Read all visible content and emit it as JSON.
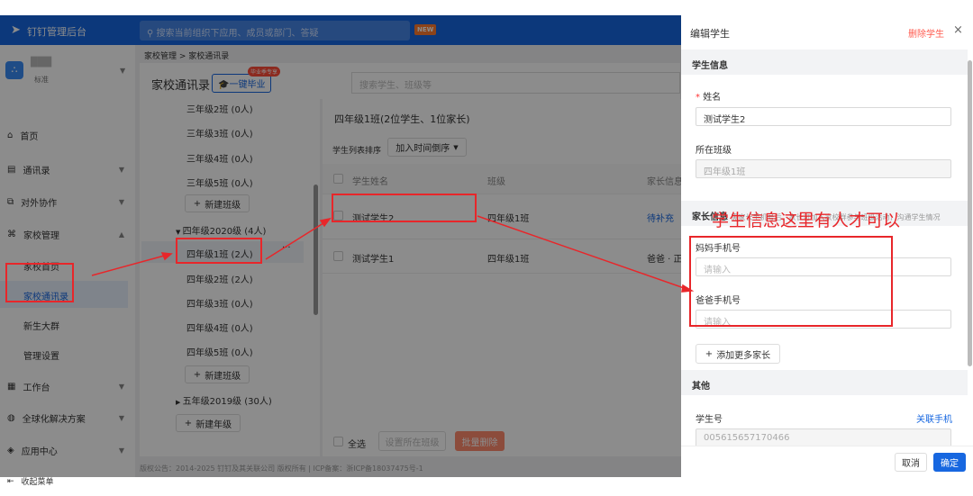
{
  "topbar": {
    "logo": "钉钉管理后台",
    "search_placeholder": "搜索当前组织下应用、成员或部门、答疑",
    "new_badge": "NEW"
  },
  "org": {
    "name": "███",
    "tag": "标准"
  },
  "sidebar": {
    "items": [
      {
        "label": "首页",
        "icon": "home-icon"
      },
      {
        "label": "通讯录",
        "icon": "contacts-icon"
      },
      {
        "label": "对外协作",
        "icon": "collab-icon"
      },
      {
        "label": "家校管理",
        "icon": "school-icon"
      },
      {
        "label": "工作台",
        "icon": "grid-icon"
      },
      {
        "label": "全球化解决方案",
        "icon": "globe-icon"
      },
      {
        "label": "应用中心",
        "icon": "app-icon"
      }
    ],
    "sub_items": [
      "家校首页",
      "家校通讯录",
      "新生大群",
      "管理设置"
    ],
    "collapse": "收起菜单"
  },
  "breadcrumb": [
    "家校管理",
    "家校通讯录"
  ],
  "page": {
    "title": "家校通讯录",
    "graduate_button": "一键毕业",
    "graduate_badge": "毕业季专享",
    "search_placeholder": "搜索学生、班级等"
  },
  "tree": {
    "nodes": [
      "三年级2班 (0人)",
      "三年级3班 (0人)",
      "三年级4班 (0人)",
      "三年级5班 (0人)"
    ],
    "new_class": "新建班级",
    "grade2020": "四年级2020级 (4人)",
    "classes2020": [
      "四年级1班 (2人)",
      "四年级2班 (2人)",
      "四年级3班 (0人)",
      "四年级4班 (0人)",
      "四年级5班 (0人)"
    ],
    "grade2019": "五年级2019级 (30人)",
    "new_grade": "新建年级"
  },
  "list": {
    "title": "四年级1班(2位学生、1位家长)",
    "sort_label": "学生列表排序",
    "sort_value": "加入时间倒序",
    "columns": [
      "学生姓名",
      "班级",
      "家长信息"
    ],
    "rows": [
      {
        "name": "测试学生2",
        "class": "四年级1班",
        "parent": "待补充"
      },
      {
        "name": "测试学生1",
        "class": "四年级1班",
        "parent": "爸爸 · 正"
      }
    ],
    "select_all": "全选",
    "set_class": "设置所在班级",
    "batch_delete": "批量删除"
  },
  "footer": "版权公告：2014-2025 钉钉及其关联公司 版权所有 | ICP备案：浙ICP备18037475号-1",
  "drawer": {
    "title": "编辑学生",
    "delete": "删除学生",
    "section_student": "学生信息",
    "name_label": "姓名",
    "name_value": "测试学生2",
    "class_label": "所在班级",
    "class_value": "四年级1班",
    "section_parent": "家长信息",
    "parent_hint": "需家长手机号后，家长可加入家校群参与班级活动，沟通学生情况",
    "mom_label": "妈妈手机号",
    "mom_placeholder": "请输入",
    "dad_label": "爸爸手机号",
    "dad_placeholder": "请输入",
    "add_parent": "添加更多家长",
    "section_other": "其他",
    "student_no_label": "学生号",
    "link_phone": "关联手机",
    "student_no_value": "005615657170466",
    "cancel": "取消",
    "confirm": "确定"
  },
  "annotation": "学生信息这里有人才可以",
  "colors": {
    "brand": "#1767e0",
    "annotation": "#e8262a",
    "danger": "#ff5a4e"
  }
}
